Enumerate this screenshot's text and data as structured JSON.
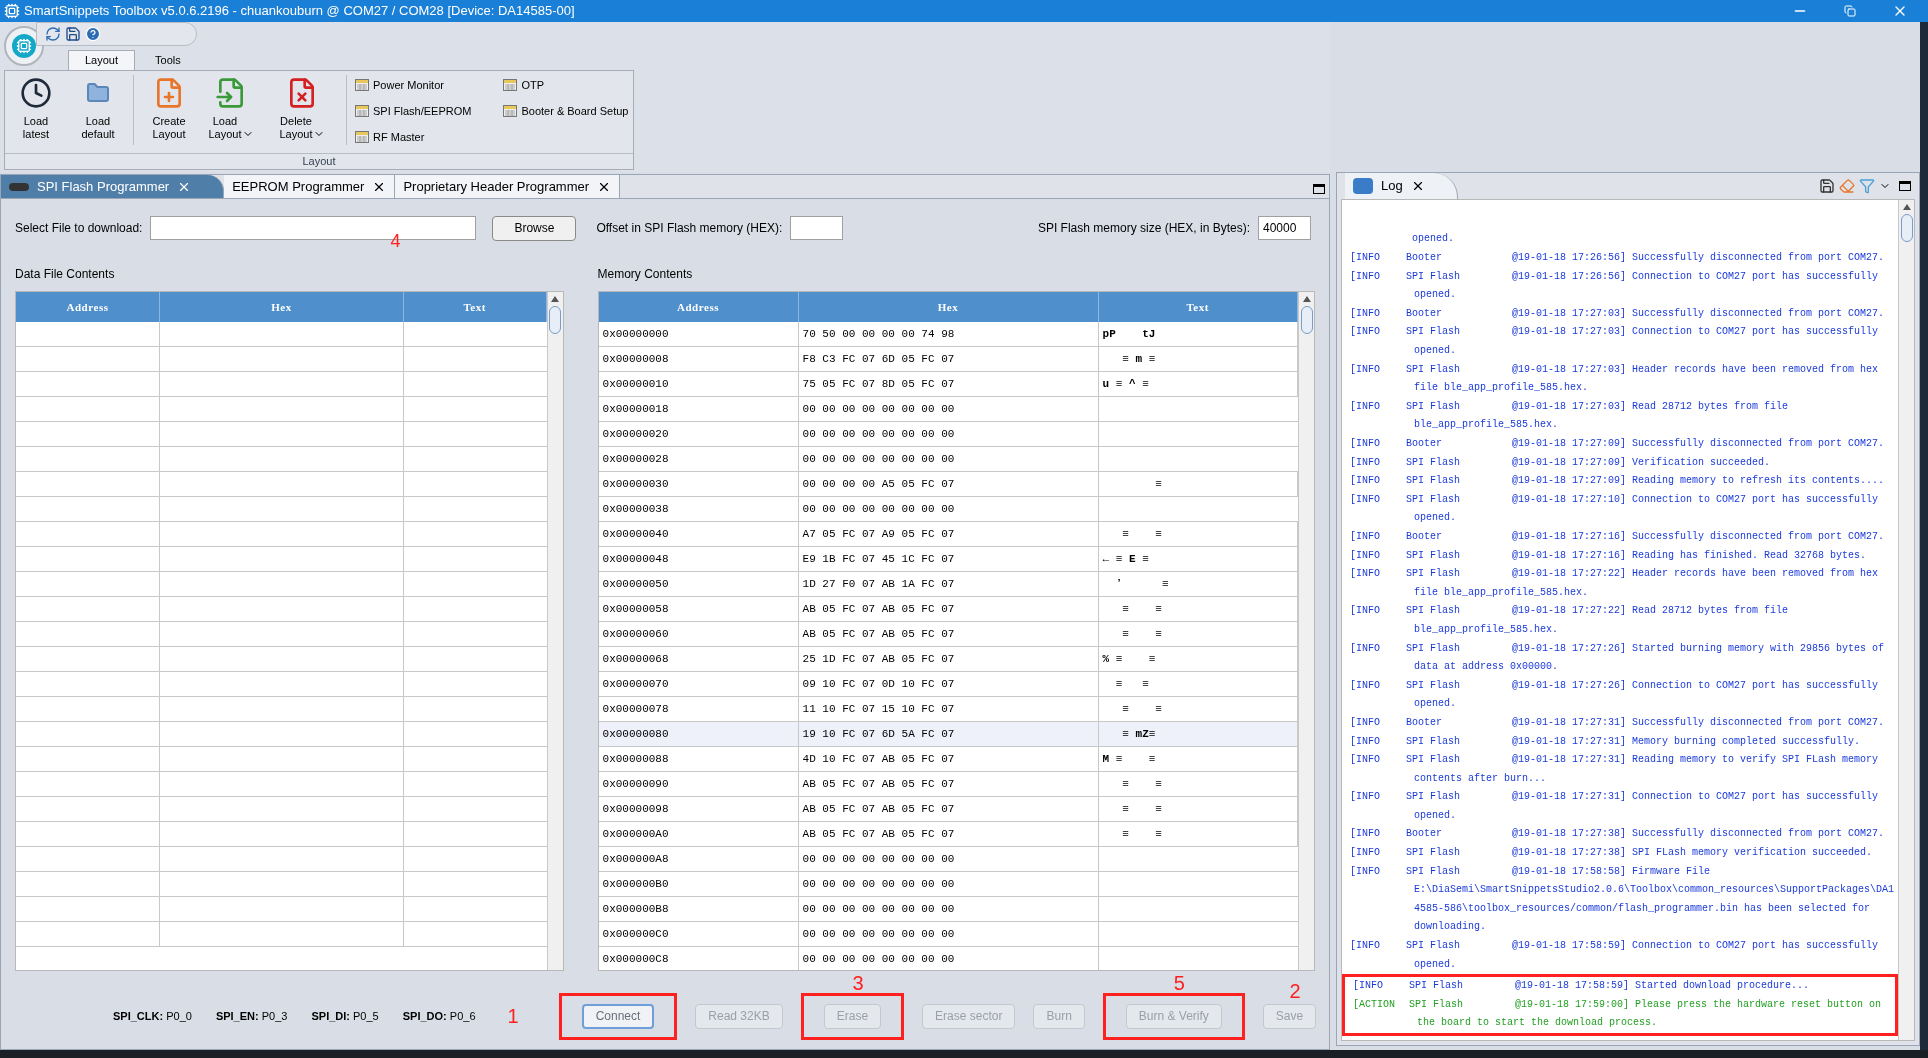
{
  "window": {
    "title": "SmartSnippets Toolbox v5.0.6.2196 - chuankouburn @ COM27 / COM28 [Device: DA14585-00]"
  },
  "ribbon": {
    "tabs": [
      {
        "label": "Layout",
        "selected": true
      },
      {
        "label": "Tools",
        "selected": false
      }
    ],
    "large_buttons": [
      {
        "kind": "clock",
        "label": "Load\nlatest",
        "dropdown": false
      },
      {
        "kind": "folder",
        "label": "Load\ndefault",
        "dropdown": false
      },
      {
        "kind": "create",
        "label": "Create\nLayout",
        "dropdown": false
      },
      {
        "kind": "load",
        "label": "Load\nLayout",
        "dropdown": true
      },
      {
        "kind": "delete",
        "label": "Delete\nLayout",
        "dropdown": true
      }
    ],
    "small_buttons": [
      {
        "label": "Power Monitor"
      },
      {
        "label": "SPI Flash/EEPROM"
      },
      {
        "label": "RF Master"
      },
      {
        "label": "OTP"
      },
      {
        "label": "Booter & Board Setup"
      }
    ],
    "group_label": "Layout"
  },
  "document_tabs": [
    {
      "label": "SPI Flash Programmer",
      "selected": true
    },
    {
      "label": "EEPROM Programmer",
      "selected": false
    },
    {
      "label": "Proprietary Header Programmer",
      "selected": false
    }
  ],
  "form": {
    "file_label": "Select File to download:",
    "file_annotation": "4",
    "browse": "Browse",
    "offset_label": "Offset in SPI Flash memory (HEX):",
    "size_label": "SPI Flash memory size (HEX, in Bytes):",
    "size_value": "40000"
  },
  "data_file": {
    "title": "Data File Contents",
    "columns": [
      "Address",
      "Hex",
      "Text"
    ]
  },
  "memory": {
    "title": "Memory Contents",
    "columns": [
      "Address",
      "Hex",
      "Text"
    ],
    "rows": [
      {
        "address": "0x00000000",
        "hex": "70 50 00 00 00 00 74 98",
        "text": "pP    tJ",
        "selected": false
      },
      {
        "address": "0x00000008",
        "hex": "F8 C3 FC 07 6D 05 FC 07",
        "text": "   ≡ m ≡",
        "selected": false
      },
      {
        "address": "0x00000010",
        "hex": "75 05 FC 07 8D 05 FC 07",
        "text": "u ≡ ^ ≡",
        "selected": false
      },
      {
        "address": "0x00000018",
        "hex": "00 00 00 00 00 00 00 00",
        "text": "",
        "selected": false
      },
      {
        "address": "0x00000020",
        "hex": "00 00 00 00 00 00 00 00",
        "text": "",
        "selected": false
      },
      {
        "address": "0x00000028",
        "hex": "00 00 00 00 00 00 00 00",
        "text": "",
        "selected": false
      },
      {
        "address": "0x00000030",
        "hex": "00 00 00 00 A5 05 FC 07",
        "text": "        ≡",
        "selected": false
      },
      {
        "address": "0x00000038",
        "hex": "00 00 00 00 00 00 00 00",
        "text": "",
        "selected": false
      },
      {
        "address": "0x00000040",
        "hex": "A7 05 FC 07 A9 05 FC 07",
        "text": "   ≡    ≡",
        "selected": false
      },
      {
        "address": "0x00000048",
        "hex": "E9 1B FC 07 45 1C FC 07",
        "text": "← ≡ E ≡",
        "selected": false
      },
      {
        "address": "0x00000050",
        "hex": "1D 27 F0 07 AB 1A FC 07",
        "text": "  ʼ      ≡",
        "selected": false
      },
      {
        "address": "0x00000058",
        "hex": "AB 05 FC 07 AB 05 FC 07",
        "text": "   ≡    ≡",
        "selected": false
      },
      {
        "address": "0x00000060",
        "hex": "AB 05 FC 07 AB 05 FC 07",
        "text": "   ≡    ≡",
        "selected": false
      },
      {
        "address": "0x00000068",
        "hex": "25 1D FC 07 AB 05 FC 07",
        "text": "% ≡    ≡",
        "selected": false
      },
      {
        "address": "0x00000070",
        "hex": "09 10 FC 07 0D 10 FC 07",
        "text": "  ≡   ≡",
        "selected": false
      },
      {
        "address": "0x00000078",
        "hex": "11 10 FC 07 15 10 FC 07",
        "text": "   ≡    ≡",
        "selected": false
      },
      {
        "address": "0x00000080",
        "hex": "19 10 FC 07 6D 5A FC 07",
        "text": "   ≡ mZ≡",
        "selected": true
      },
      {
        "address": "0x00000088",
        "hex": "4D 10 FC 07 AB 05 FC 07",
        "text": "M ≡    ≡",
        "selected": false
      },
      {
        "address": "0x00000090",
        "hex": "AB 05 FC 07 AB 05 FC 07",
        "text": "   ≡    ≡",
        "selected": false
      },
      {
        "address": "0x00000098",
        "hex": "AB 05 FC 07 AB 05 FC 07",
        "text": "   ≡    ≡",
        "selected": false
      },
      {
        "address": "0x000000A0",
        "hex": "AB 05 FC 07 AB 05 FC 07",
        "text": "   ≡    ≡",
        "selected": false
      },
      {
        "address": "0x000000A8",
        "hex": "00 00 00 00 00 00 00 00",
        "text": "",
        "selected": false
      },
      {
        "address": "0x000000B0",
        "hex": "00 00 00 00 00 00 00 00",
        "text": "",
        "selected": false
      },
      {
        "address": "0x000000B8",
        "hex": "00 00 00 00 00 00 00 00",
        "text": "",
        "selected": false
      },
      {
        "address": "0x000000C0",
        "hex": "00 00 00 00 00 00 00 00",
        "text": "",
        "selected": false
      },
      {
        "address": "0x000000C8",
        "hex": "00 00 00 00 00 00 00 00",
        "text": "",
        "selected": false
      }
    ]
  },
  "pins": [
    {
      "label": "SPI_CLK:",
      "value": "P0_0"
    },
    {
      "label": "SPI_EN:",
      "value": "P0_3"
    },
    {
      "label": "SPI_DI:",
      "value": "P0_5"
    },
    {
      "label": "SPI_DO:",
      "value": "P0_6"
    }
  ],
  "pins_annotation": "1",
  "buttons": [
    {
      "label": "Connect",
      "disabled": false,
      "boxed": true
    },
    {
      "label": "Read 32KB",
      "disabled": true,
      "boxed": false
    },
    {
      "label": "Erase",
      "disabled": true,
      "annotation": "3",
      "boxed": true
    },
    {
      "label": "Erase sector",
      "disabled": true,
      "boxed": false
    },
    {
      "label": "Burn",
      "disabled": true,
      "boxed": false
    },
    {
      "label": "Burn & Verify",
      "disabled": true,
      "annotation": "5",
      "boxed": true
    },
    {
      "label": "Save",
      "disabled": true,
      "annotation": "2",
      "boxed": false
    }
  ],
  "log": {
    "tab": "Log",
    "top_continuation": "opened.",
    "entries": [
      {
        "kind": "info",
        "level": "[INFO",
        "source": "Booter",
        "time": "@19-01-18 17:26:56]",
        "message": "Successfully disconnected from port COM27.",
        "boxed": false
      },
      {
        "kind": "info",
        "level": "[INFO",
        "source": "SPI Flash",
        "time": "@19-01-18 17:26:56]",
        "message": "Connection to COM27 port has successfully opened.",
        "boxed": false
      },
      {
        "kind": "info",
        "level": "[INFO",
        "source": "Booter",
        "time": "@19-01-18 17:27:03]",
        "message": "Successfully disconnected from port COM27.",
        "boxed": false
      },
      {
        "kind": "info",
        "level": "[INFO",
        "source": "SPI Flash",
        "time": "@19-01-18 17:27:03]",
        "message": "Connection to COM27 port has successfully opened.",
        "boxed": false
      },
      {
        "kind": "info",
        "level": "[INFO",
        "source": "SPI Flash",
        "time": "@19-01-18 17:27:03]",
        "message": "Header records have been removed from hex file ble_app_profile_585.hex.",
        "boxed": false
      },
      {
        "kind": "info",
        "level": "[INFO",
        "source": "SPI Flash",
        "time": "@19-01-18 17:27:03]",
        "message": "Read 28712 bytes from file ble_app_profile_585.hex.",
        "boxed": false
      },
      {
        "kind": "info",
        "level": "[INFO",
        "source": "Booter",
        "time": "@19-01-18 17:27:09]",
        "message": "Successfully disconnected from port COM27.",
        "boxed": false
      },
      {
        "kind": "info",
        "level": "[INFO",
        "source": "SPI Flash",
        "time": "@19-01-18 17:27:09]",
        "message": "Verification succeeded.",
        "boxed": false
      },
      {
        "kind": "info",
        "level": "[INFO",
        "source": "SPI Flash",
        "time": "@19-01-18 17:27:09]",
        "message": "Reading memory to refresh its contents....",
        "boxed": false
      },
      {
        "kind": "info",
        "level": "[INFO",
        "source": "SPI Flash",
        "time": "@19-01-18 17:27:10]",
        "message": "Connection to COM27 port has successfully opened.",
        "boxed": false
      },
      {
        "kind": "info",
        "level": "[INFO",
        "source": "Booter",
        "time": "@19-01-18 17:27:16]",
        "message": "Successfully disconnected from port COM27.",
        "boxed": false
      },
      {
        "kind": "info",
        "level": "[INFO",
        "source": "SPI Flash",
        "time": "@19-01-18 17:27:16]",
        "message": "Reading has finished. Read 32768 bytes.",
        "boxed": false
      },
      {
        "kind": "info",
        "level": "[INFO",
        "source": "SPI Flash",
        "time": "@19-01-18 17:27:22]",
        "message": "Header records have been removed from hex file ble_app_profile_585.hex.",
        "boxed": false
      },
      {
        "kind": "info",
        "level": "[INFO",
        "source": "SPI Flash",
        "time": "@19-01-18 17:27:22]",
        "message": "Read 28712 bytes from file ble_app_profile_585.hex.",
        "boxed": false
      },
      {
        "kind": "info",
        "level": "[INFO",
        "source": "SPI Flash",
        "time": "@19-01-18 17:27:26]",
        "message": "Started burning memory with 29856 bytes of data at address 0x00000.",
        "boxed": false
      },
      {
        "kind": "info",
        "level": "[INFO",
        "source": "SPI Flash",
        "time": "@19-01-18 17:27:26]",
        "message": "Connection to COM27 port has successfully opened.",
        "boxed": false
      },
      {
        "kind": "info",
        "level": "[INFO",
        "source": "Booter",
        "time": "@19-01-18 17:27:31]",
        "message": "Successfully disconnected from port COM27.",
        "boxed": false
      },
      {
        "kind": "info",
        "level": "[INFO",
        "source": "SPI Flash",
        "time": "@19-01-18 17:27:31]",
        "message": "Memory burning completed successfully.",
        "boxed": false
      },
      {
        "kind": "info",
        "level": "[INFO",
        "source": "SPI Flash",
        "time": "@19-01-18 17:27:31]",
        "message": "Reading memory to verify SPI FLash memory contents after burn...",
        "boxed": false
      },
      {
        "kind": "info",
        "level": "[INFO",
        "source": "SPI Flash",
        "time": "@19-01-18 17:27:31]",
        "message": "Connection to COM27 port has successfully opened.",
        "boxed": false
      },
      {
        "kind": "info",
        "level": "[INFO",
        "source": "Booter",
        "time": "@19-01-18 17:27:38]",
        "message": "Successfully disconnected from port COM27.",
        "boxed": false
      },
      {
        "kind": "info",
        "level": "[INFO",
        "source": "SPI Flash",
        "time": "@19-01-18 17:27:38]",
        "message": "SPI FLash memory verification succeeded.",
        "boxed": false
      },
      {
        "kind": "info",
        "level": "[INFO",
        "source": "SPI Flash",
        "time": "@19-01-18 17:58:58]",
        "message": "Firmware File E:\\DiaSemi\\SmartSnippetsStudio2.0.6\\Toolbox\\common_resources\\SupportPackages\\DA14585-586\\toolbox_resources/common/flash_programmer.bin has been selected for downloading.",
        "boxed": false
      },
      {
        "kind": "info",
        "level": "[INFO",
        "source": "SPI Flash",
        "time": "@19-01-18 17:58:59]",
        "message": "Connection to COM27 port has successfully opened.",
        "boxed": false
      },
      {
        "kind": "info",
        "level": "[INFO",
        "source": "SPI Flash",
        "time": "@19-01-18 17:58:59]",
        "message": "Started download procedure...",
        "boxed": true
      },
      {
        "kind": "action",
        "level": "[ACTION",
        "source": "SPI Flash",
        "time": "@19-01-18 17:59:00]",
        "message": "Please press the hardware reset button on the board to start the download process.",
        "boxed": true
      }
    ]
  }
}
